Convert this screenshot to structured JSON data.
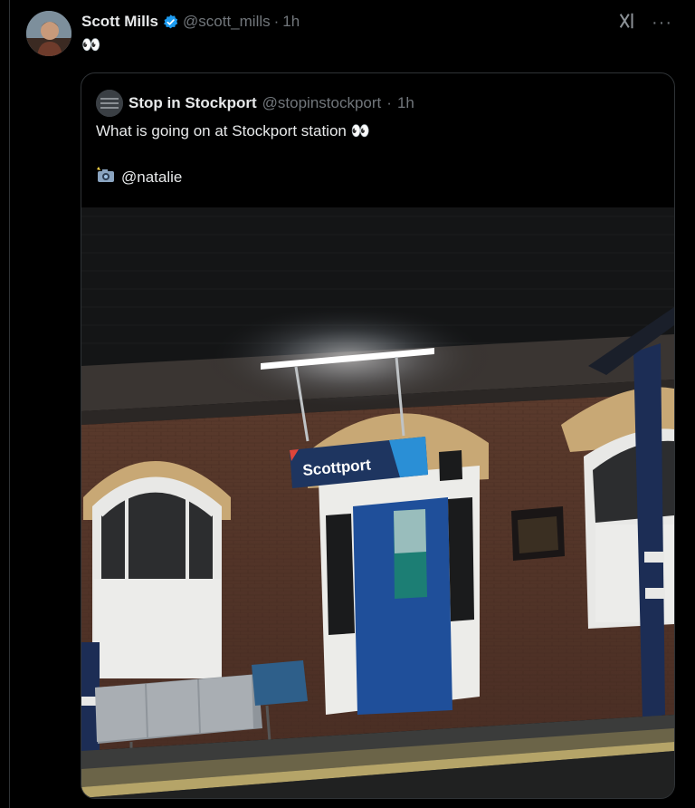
{
  "post": {
    "author_name": "Scott Mills",
    "author_handle": "@scott_mills",
    "separator": "·",
    "time": "1h",
    "text": "👀"
  },
  "quote": {
    "author_name": "Stop in Stockport",
    "author_handle": "@stopinstockport",
    "separator": "·",
    "time": "1h",
    "text": "What is going on at Stockport station 👀",
    "credit": "@natalie"
  },
  "photo": {
    "sign_text": "Scottport"
  },
  "icons": {
    "verified": "verified-badge-icon",
    "grok": "grok-icon",
    "more": "more-icon",
    "camera": "camera-flash-icon"
  },
  "colors": {
    "background": "#000000",
    "text_primary": "#e7e9ea",
    "text_secondary": "#71767b",
    "verified": "#1d9bf0",
    "sign_navy": "#1e3560",
    "sign_blue": "#2a8fd6",
    "sign_red": "#e0453a"
  }
}
